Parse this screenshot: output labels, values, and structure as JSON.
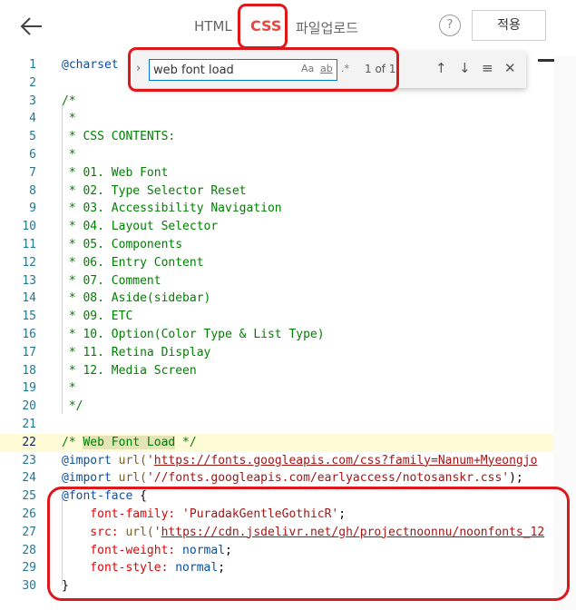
{
  "header": {
    "tabs": [
      {
        "label": "HTML"
      },
      {
        "label": "CSS"
      },
      {
        "label": "파일업로드"
      }
    ],
    "help_label": "?",
    "apply_label": "적용"
  },
  "find": {
    "value": "web font load",
    "options": [
      "Aa",
      "ab",
      ".*"
    ],
    "count": "1 of 1"
  },
  "editor": {
    "lines": [
      {
        "num": "1"
      },
      {
        "num": "2"
      },
      {
        "num": "3"
      },
      {
        "num": "4"
      },
      {
        "num": "5"
      },
      {
        "num": "6"
      },
      {
        "num": "7"
      },
      {
        "num": "8"
      },
      {
        "num": "9"
      },
      {
        "num": "10"
      },
      {
        "num": "11"
      },
      {
        "num": "12"
      },
      {
        "num": "13"
      },
      {
        "num": "14"
      },
      {
        "num": "15"
      },
      {
        "num": "16"
      },
      {
        "num": "17"
      },
      {
        "num": "18"
      },
      {
        "num": "19"
      },
      {
        "num": "20"
      },
      {
        "num": "21"
      },
      {
        "num": "22"
      },
      {
        "num": "23"
      },
      {
        "num": "24"
      },
      {
        "num": "25"
      },
      {
        "num": "26"
      },
      {
        "num": "27"
      },
      {
        "num": "28"
      },
      {
        "num": "29"
      },
      {
        "num": "30"
      }
    ],
    "code": {
      "l1": "@charset",
      "l3": "/*",
      "l4": " *",
      "l5": " * CSS CONTENTS:",
      "l6": " *",
      "l7": " * 01. Web Font",
      "l8": " * 02. Type Selector Reset",
      "l9": " * 03. Accessibility Navigation",
      "l10": " * 04. Layout Selector",
      "l11": " * 05. Components",
      "l12": " * 06. Entry Content",
      "l13": " * 07. Comment",
      "l14": " * 08. Aside(sidebar)",
      "l15": " * 09. ETC",
      "l16": " * 10. Option(Color Type & List Type)",
      "l17": " * 11. Retina Display",
      "l18": " * 12. Media Screen",
      "l19": " *",
      "l20": " */",
      "l22a": "/* ",
      "l22b": "Web Font Load",
      "l22c": " */",
      "l23a": "@import",
      "l23b": " url(",
      "l23c": "'",
      "l23d": "https://fonts.googleapis.com/css?family=Nanum+Myeongjo",
      "l24a": "@import",
      "l24b": " url(",
      "l24c": "'//fonts.googleapis.com/earlyaccess/notosanskr.css'",
      "l24d": ");",
      "l25a": "@font-face",
      "l25b": " {",
      "l26a": "    font-family:",
      "l26b": " 'PuradakGentleGothicR'",
      "l26c": ";",
      "l27a": "    src:",
      "l27b": " url(",
      "l27c": "'",
      "l27d": "https://cdn.jsdelivr.net/gh/projectnoonnu/noonfonts_12",
      "l28a": "    font-weight:",
      "l28b": " normal",
      "l28c": ";",
      "l29a": "    font-style:",
      "l29b": " normal",
      "l29c": ";",
      "l30": "}"
    }
  },
  "colors": {
    "accent": "#e8453c",
    "highlight_outline": "#e0171a",
    "line_number": "#237893",
    "comment": "#008000"
  },
  "icons": [
    "back-arrow-icon",
    "help-icon",
    "chevron-right-icon",
    "arrow-up-icon",
    "arrow-down-icon",
    "selection-icon",
    "close-icon"
  ]
}
